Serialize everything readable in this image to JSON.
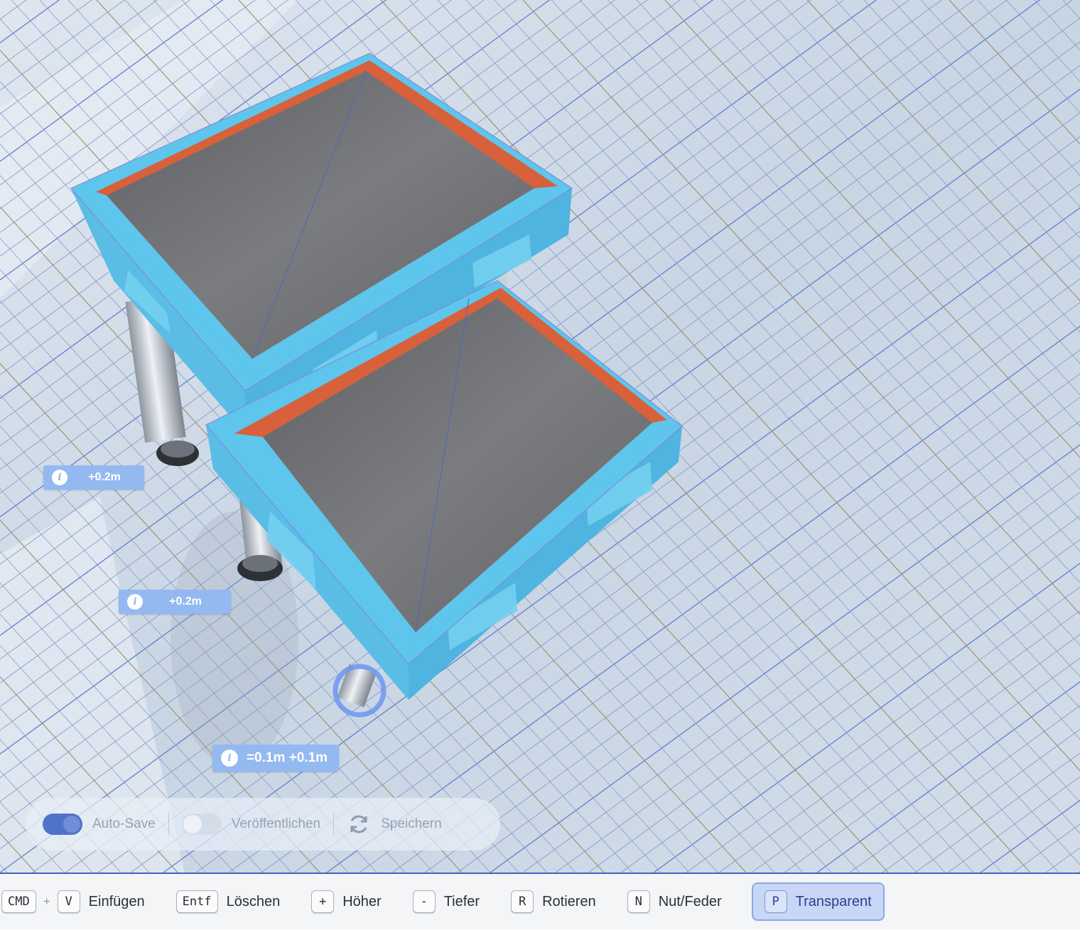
{
  "scene": {
    "labels": [
      {
        "text": "+0.2m"
      },
      {
        "text": "+0.2m"
      },
      {
        "text": "=0.1m +0.1m"
      }
    ]
  },
  "save_bar": {
    "autosave_label": "Auto-Save",
    "autosave_on": true,
    "publish_label": "Veröffentlichen",
    "publish_on": false,
    "save_label": "Speichern"
  },
  "shortcuts": [
    {
      "keys": [
        "CMD",
        "V"
      ],
      "joiner": "+",
      "label": "Einfügen",
      "active": false
    },
    {
      "keys": [
        "Entf"
      ],
      "label": "Löschen",
      "active": false
    },
    {
      "keys": [
        "+"
      ],
      "label": "Höher",
      "active": false
    },
    {
      "keys": [
        "-"
      ],
      "label": "Tiefer",
      "active": false
    },
    {
      "keys": [
        "R"
      ],
      "label": "Rotieren",
      "active": false
    },
    {
      "keys": [
        "N"
      ],
      "label": "Nut/Feder",
      "active": false
    },
    {
      "keys": [
        "P"
      ],
      "label": "Transparent",
      "active": true
    }
  ],
  "colors": {
    "accent": "#3f64c2",
    "platform_frame": "#5ec5ec",
    "platform_edge": "#d8603a",
    "platform_top": "#6f6f73",
    "label_bg": "#93b9f0"
  }
}
